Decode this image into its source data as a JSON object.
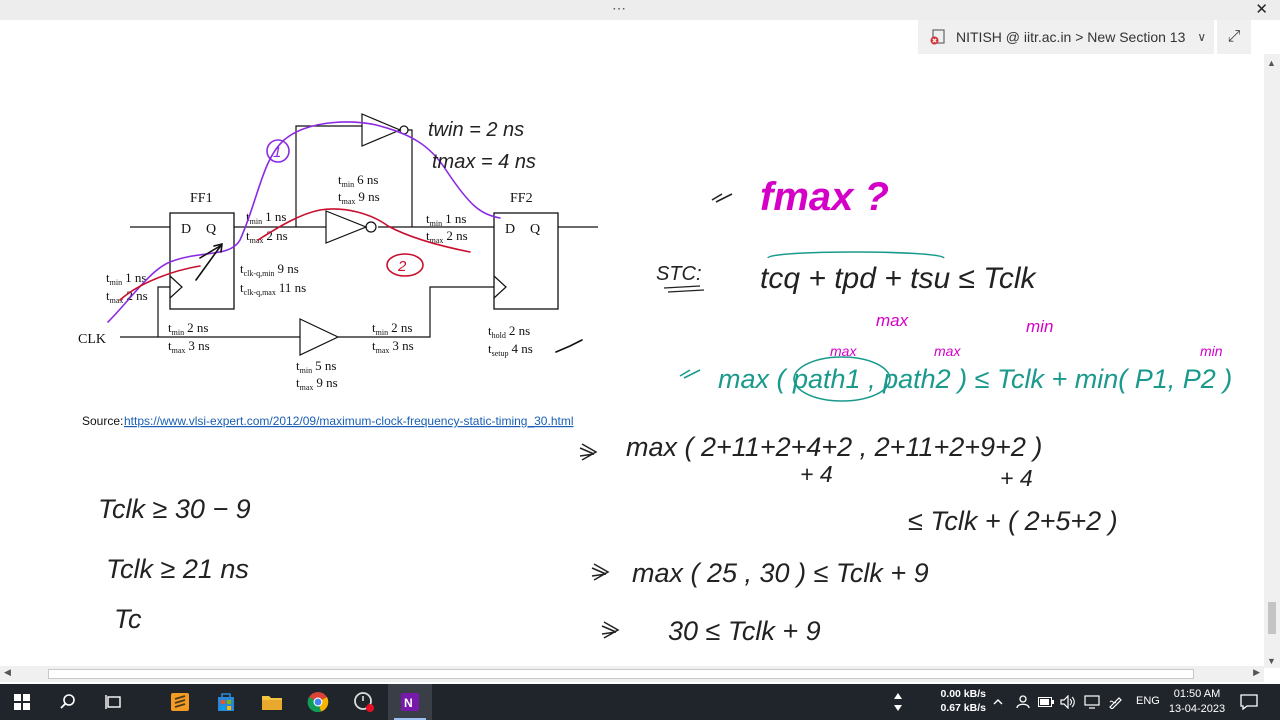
{
  "window": {
    "more_glyph": "⋯",
    "close_glyph": "✕"
  },
  "breadcrumb": {
    "text": "NITISH @ iitr.ac.in > New Section 13",
    "chevron": "∨",
    "expand_glyph": "⤢"
  },
  "diagram": {
    "ff1_label": "FF1",
    "ff2_label": "FF2",
    "d_label": "D",
    "q_label": "Q",
    "clk_label": "CLK",
    "path1_circle": "1",
    "path2_circle": "2",
    "top_tmin": "twin = 2 ns",
    "top_tmax": "tmax = 4 ns",
    "ff1_out_min": "1 ns",
    "ff1_out_max": "2 ns",
    "inv_min": "6 ns",
    "inv_max": "9 ns",
    "ff2_in_min": "1 ns",
    "ff2_in_max": "2 ns",
    "clk_ff1_min": "1 ns",
    "clk_ff1_max": "2 ns",
    "clkq_min": "9 ns",
    "clkq_max": "11 ns",
    "clkbuf_in_min": "2 ns",
    "clkbuf_in_max": "3 ns",
    "buf_min": "5 ns",
    "buf_max": "9 ns",
    "clkbuf_out_min": "2 ns",
    "clkbuf_out_max": "3 ns",
    "hold": "2 ns",
    "setup": "4 ns",
    "source_label": "Source:",
    "source_url": "https://www.vlsi-expert.com/2012/09/maximum-clock-frequency-static-timing_30.html"
  },
  "notes": {
    "fmax": "fmax ?",
    "stc": "STC:",
    "stc_eq": "tcq + tpd + tsu ≤ Tclk",
    "max_label": "max",
    "min_label": "min",
    "general": "max ( path1 , path2 ) ≤ Tclk + min( P1, P2 )",
    "calc1": "max ( 2+11+2+4+2 , 2+11+2+9+2 )",
    "calc1_sub1": "+ 4",
    "calc1_sub2": "+ 4",
    "calc2": "≤ Tclk + ( 2+5+2 )",
    "calc3": "max ( 25 , 30 ) ≤ Tclk + 9",
    "calc4": "30 ≤ Tclk + 9",
    "left1": "Tclk ≥ 30 − 9",
    "left2": "Tclk ≥ 21 ns",
    "left3": "Tc"
  },
  "taskbar": {
    "net_up": "0.00 kB/s",
    "net_down": "0.67 kB/s",
    "lang": "ENG",
    "time": "01:50 AM",
    "date": "13-04-2023"
  },
  "colors": {
    "pen_magenta": "#d400c8",
    "pen_teal": "#1a9a8c",
    "pen_red": "#c8102e",
    "pen_purple": "#8a2be2",
    "pen_black": "#222222",
    "link_blue": "#1a5fb4",
    "taskbar": "#20252c"
  }
}
